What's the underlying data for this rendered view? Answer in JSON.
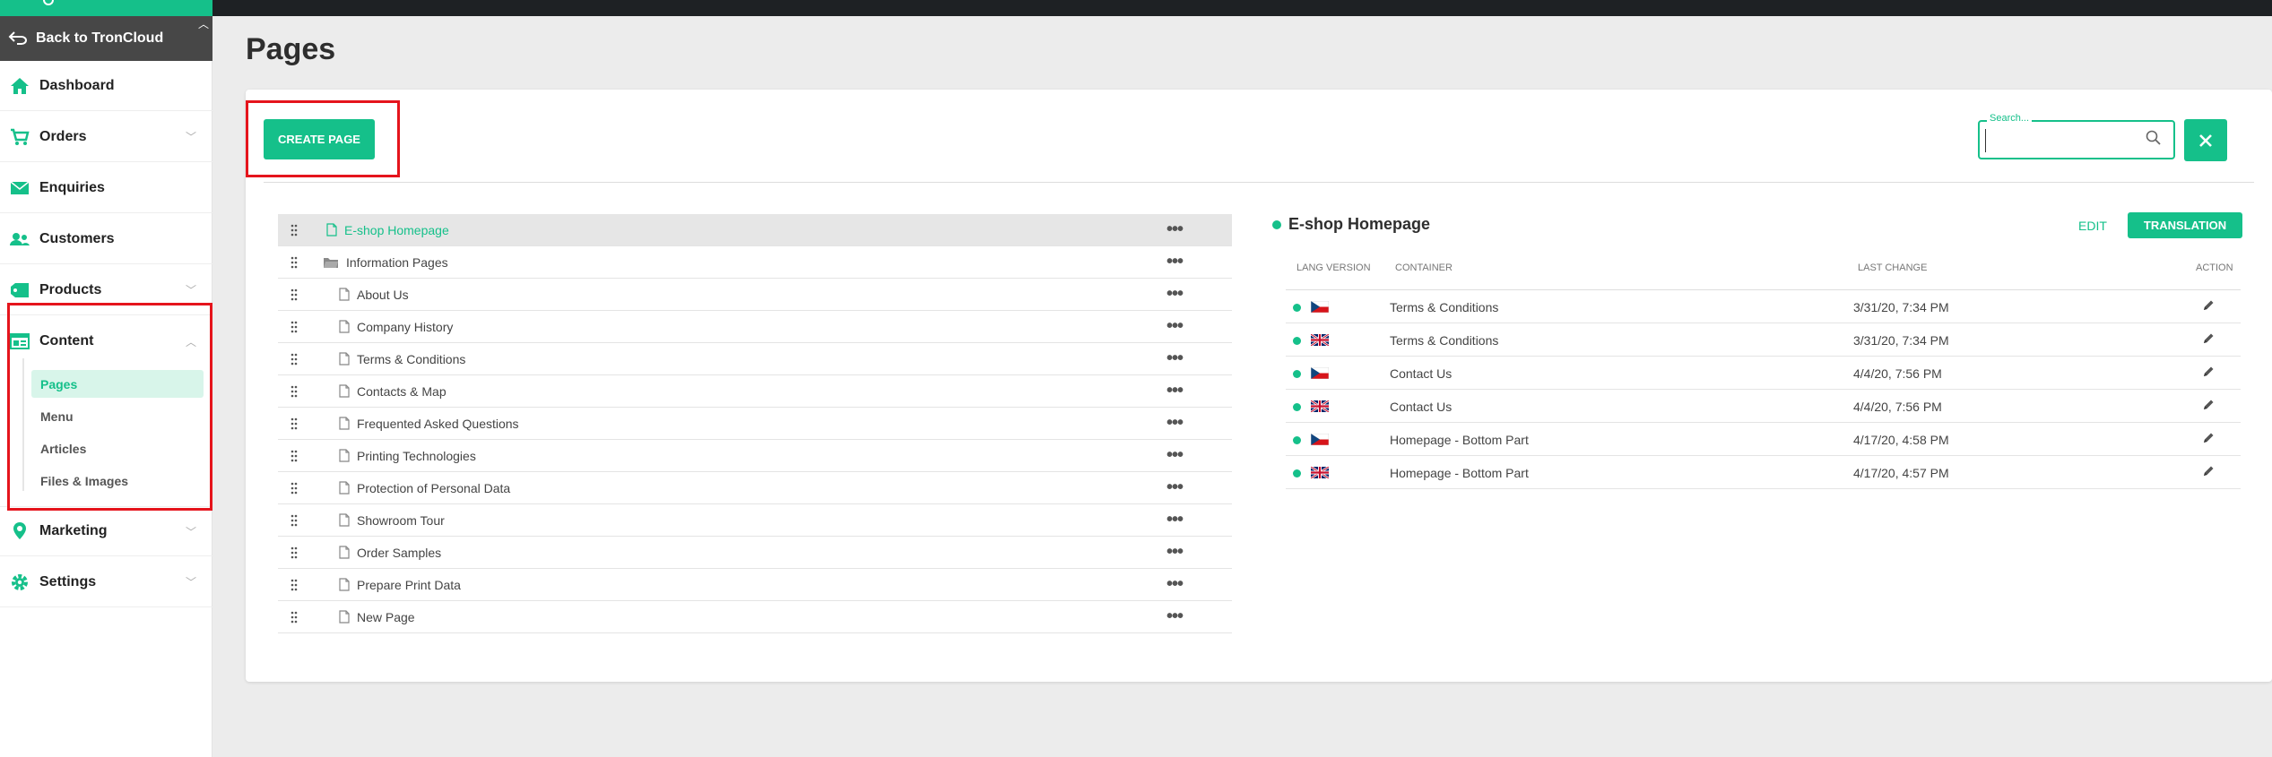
{
  "sidebar": {
    "back_label": "Back to TronCloud",
    "items": [
      {
        "label": "Dashboard",
        "icon": "home-icon"
      },
      {
        "label": "Orders",
        "icon": "cart-icon"
      },
      {
        "label": "Enquiries",
        "icon": "envelope-icon"
      },
      {
        "label": "Customers",
        "icon": "users-icon"
      },
      {
        "label": "Products",
        "icon": "tag-icon"
      },
      {
        "label": "Content",
        "icon": "content-icon"
      },
      {
        "label": "Marketing",
        "icon": "map-pin-icon"
      },
      {
        "label": "Settings",
        "icon": "gear-icon"
      }
    ],
    "content_sub": [
      {
        "label": "Pages",
        "active": true
      },
      {
        "label": "Menu"
      },
      {
        "label": "Articles"
      },
      {
        "label": "Files & Images"
      }
    ]
  },
  "page": {
    "title": "Pages",
    "create_label": "CREATE PAGE",
    "search_label": "Search...",
    "search_value": ""
  },
  "tree": [
    {
      "name": "E-shop Homepage",
      "type": "page",
      "selected": true
    },
    {
      "name": "Information Pages",
      "type": "folder"
    },
    {
      "name": "About Us",
      "type": "page"
    },
    {
      "name": "Company History",
      "type": "page"
    },
    {
      "name": "Terms & Conditions",
      "type": "page"
    },
    {
      "name": "Contacts & Map",
      "type": "page"
    },
    {
      "name": "Frequented Asked Questions",
      "type": "page"
    },
    {
      "name": "Printing Technologies",
      "type": "page"
    },
    {
      "name": "Protection of Personal Data",
      "type": "page"
    },
    {
      "name": "Showroom Tour",
      "type": "page"
    },
    {
      "name": "Order Samples",
      "type": "page"
    },
    {
      "name": "Prepare Print Data",
      "type": "page"
    },
    {
      "name": "New Page",
      "type": "page"
    }
  ],
  "detail": {
    "title": "E-shop Homepage",
    "edit_label": "EDIT",
    "translation_label": "TRANSLATION",
    "headers": {
      "lang": "LANG VERSION",
      "container": "CONTAINER",
      "last_change": "LAST CHANGE",
      "action": "ACTION"
    },
    "rows": [
      {
        "flag": "cz",
        "container": "Terms & Conditions",
        "last_change": "3/31/20, 7:34 PM"
      },
      {
        "flag": "gb",
        "container": "Terms & Conditions",
        "last_change": "3/31/20, 7:34 PM"
      },
      {
        "flag": "cz",
        "container": "Contact Us",
        "last_change": "4/4/20, 7:56 PM"
      },
      {
        "flag": "gb",
        "container": "Contact Us",
        "last_change": "4/4/20, 7:56 PM"
      },
      {
        "flag": "cz",
        "container": "Homepage - Bottom Part",
        "last_change": "4/17/20, 4:58 PM"
      },
      {
        "flag": "gb",
        "container": "Homepage - Bottom Part",
        "last_change": "4/17/20, 4:57 PM"
      }
    ]
  },
  "colors": {
    "accent": "#15c08a",
    "highlight": "#e5141c",
    "sidebar_dark": "#474747"
  }
}
